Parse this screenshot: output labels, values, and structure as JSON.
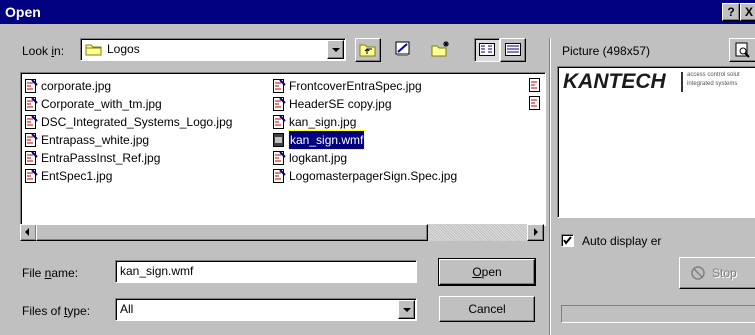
{
  "title": "Open",
  "title_buttons": {
    "help": "?",
    "close": "X"
  },
  "look_in": {
    "label": "Look in:",
    "value": "Logos"
  },
  "file_columns": [
    [
      "corporate.jpg",
      "Corporate_with_tm.jpg",
      "DSC_Integrated_Systems_Logo.jpg",
      "Entrapass_white.jpg",
      "EntraPassInst_Ref.jpg",
      "EntSpec1.jpg"
    ],
    [
      "FrontcoverEntraSpec.jpg",
      "HeaderSE copy.jpg",
      "kan_sign.jpg",
      "kan_sign.wmf",
      "logkant.jpg",
      "LogomasterpagerSign.Spec.jpg"
    ]
  ],
  "selected_file": "kan_sign.wmf",
  "file_name": {
    "label": "File name:",
    "value": "kan_sign.wmf"
  },
  "file_type": {
    "label": "Files of type:",
    "value": "All"
  },
  "buttons": {
    "open": "Open",
    "cancel": "Cancel",
    "stop": "Stop"
  },
  "preview": {
    "label": "Picture (498x57)",
    "logo_text": "KANTECH",
    "logo_tag_1": "access control solut",
    "logo_tag_2": "integrated systems",
    "auto_display_label": "Auto display er",
    "auto_display_checked": true
  }
}
